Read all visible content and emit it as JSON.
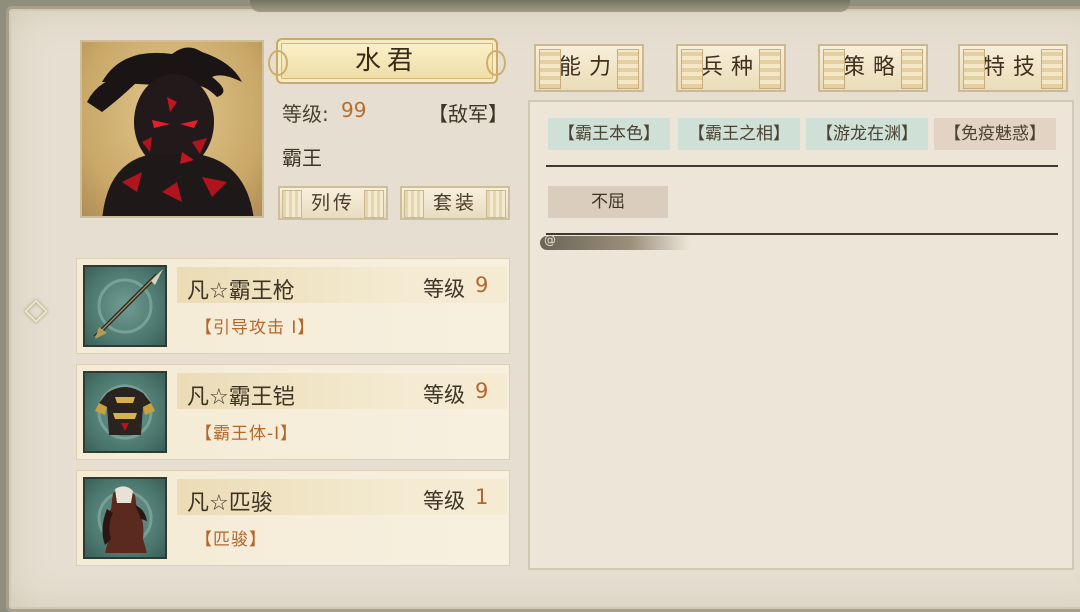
{
  "general": {
    "name": "水君",
    "level_label": "等级:",
    "level_value": "99",
    "faction": "【敌军】",
    "title": "霸王"
  },
  "buttons": {
    "biography": "列传",
    "set": "套装"
  },
  "tabs": [
    {
      "label": "能力"
    },
    {
      "label": "兵种"
    },
    {
      "label": "策略"
    },
    {
      "label": "特技"
    }
  ],
  "skills": [
    {
      "label": "【霸王本色】",
      "color": "#cfe0d6"
    },
    {
      "label": "【霸王之相】",
      "color": "#cfe0d6"
    },
    {
      "label": "【游龙在渊】",
      "color": "#cfe0d6"
    },
    {
      "label": "【免疫魅惑】",
      "color": "#e2d3c3"
    }
  ],
  "traits": [
    {
      "label": "不屈"
    }
  ],
  "equipment": [
    {
      "name": "凡☆霸王枪",
      "level_label": "等级",
      "level_value": "9",
      "skill": "【引导攻击 Ⅰ】",
      "icon": "spear-icon"
    },
    {
      "name": "凡☆霸王铠",
      "level_label": "等级",
      "level_value": "9",
      "skill": "【霸王体-Ⅰ】",
      "icon": "armor-icon"
    },
    {
      "name": "凡☆匹骏",
      "level_label": "等级",
      "level_value": "1",
      "skill": "【匹骏】",
      "icon": "horse-icon"
    }
  ],
  "colors": {
    "accent_orange": "#b4672b",
    "panel_bg": "#e6dfd1",
    "tag_green": "#cfe0d6",
    "tag_rose": "#e2d3c3"
  }
}
